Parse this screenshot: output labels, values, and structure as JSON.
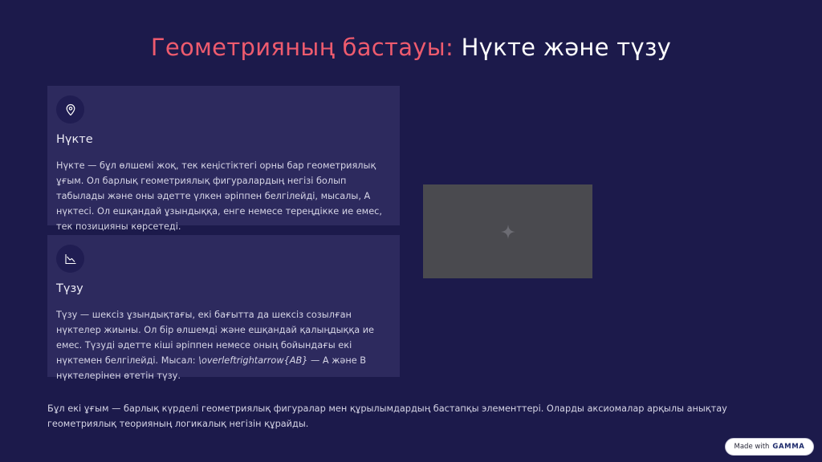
{
  "title": {
    "accent": "Геометрияның бастауы:",
    "main": "Нүкте және түзу"
  },
  "cards": [
    {
      "icon": "map-pin-icon",
      "title": "Нүкте",
      "text": "Нүкте — бұл өлшемі жоқ, тек кеңістіктегі орны бар геометриялық ұғым. Ол барлық геометриялық фигуралардың негізі болып табылады және оны әдетте үлкен әріппен белгілейді, мысалы, A нүктесі. Ол ешқандай ұзындыққа, енге немесе тереңдікке ие емес, тек позицияны көрсетеді."
    },
    {
      "icon": "trend-line-icon",
      "title": "Түзу",
      "text_before": "Түзу — шексіз ұзындықтағы, екі бағытта да шексіз созылған нүктелер жиыны. Ол бір өлшемді және ешқандай қалыңдыққа ие емес. Түзуді әдетте кіші әріппен немесе оның бойындағы екі нүктемен белгілейді. Мысал: ",
      "formula": "\\overleftrightarrow{AB}",
      "text_after": " — A және B нүктелерінен өтетін түзу."
    }
  ],
  "image_placeholder": {
    "icon": "sparkle-icon"
  },
  "footer": "Бұл екі ұғым — барлық күрделі геометриялық фигуралар мен құрылымдардың бастапқы элементтері. Оларды аксиомалар арқылы анықтау геометриялық теорияның логикалық негізін құрайды.",
  "badge": {
    "prefix": "Made with",
    "brand": "GAMMA"
  }
}
